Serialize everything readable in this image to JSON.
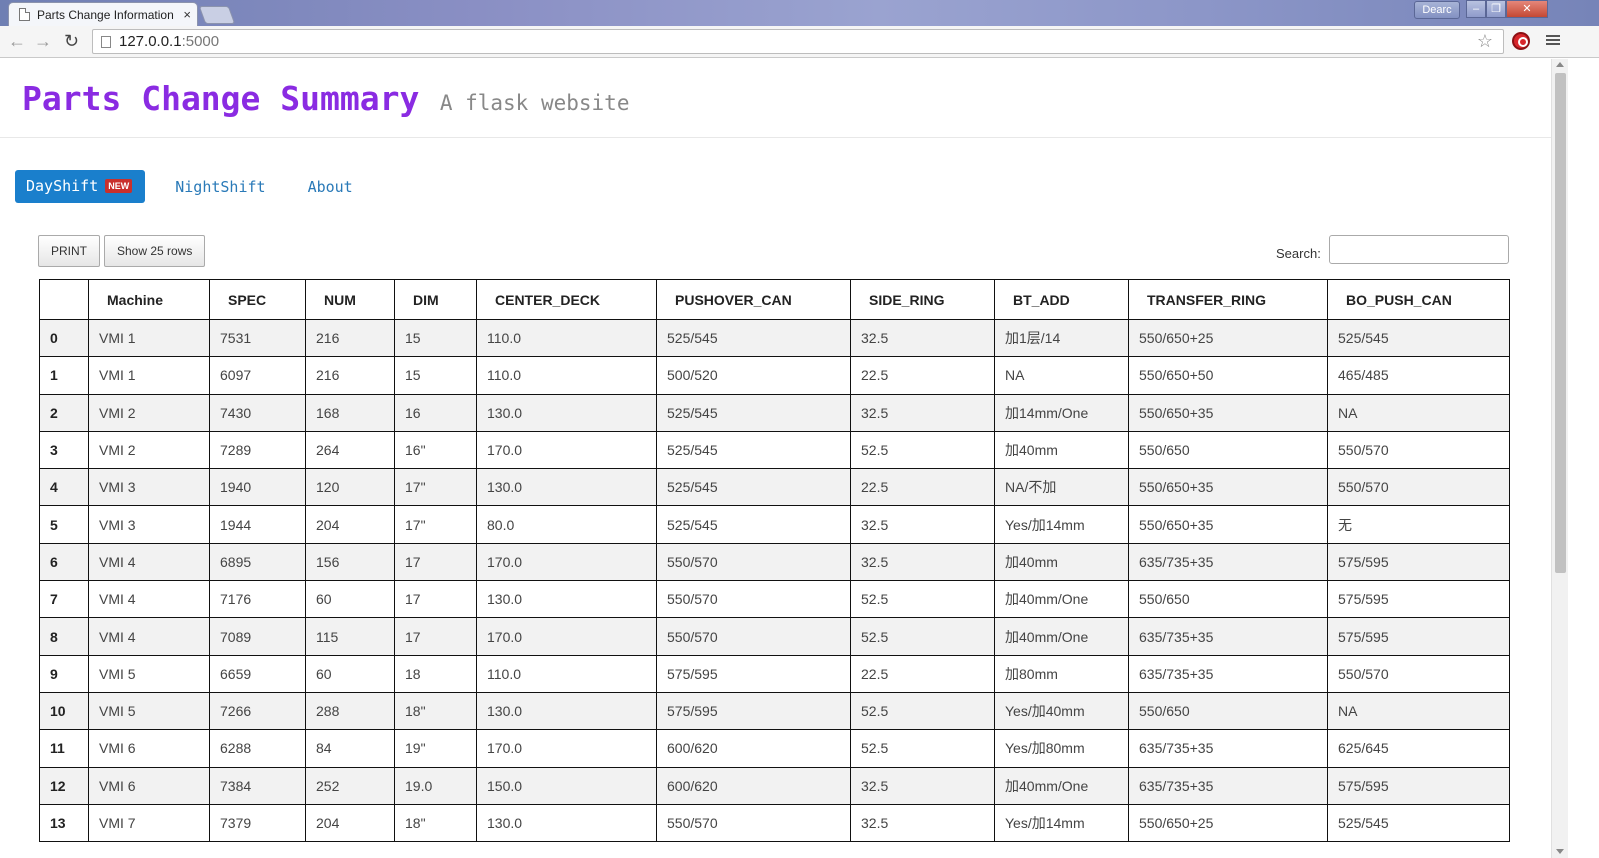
{
  "browser": {
    "tab_title": "Parts Change Information",
    "tab_close": "×",
    "user": "Dearc",
    "address_host": "127.0.0.1",
    "address_port": ":5000",
    "back": "←",
    "forward": "→",
    "reload": "↻",
    "star": "☆"
  },
  "header": {
    "title": "Parts Change Summary",
    "subtitle": "A flask website"
  },
  "nav": {
    "items": [
      "DayShift",
      "NightShift",
      "About"
    ],
    "badge": "NEW"
  },
  "toolbar": {
    "print_label": "PRINT",
    "rows_label": "Show 25 rows",
    "search_label": "Search:",
    "search_value": ""
  },
  "table": {
    "columns": [
      "",
      "Machine",
      "SPEC",
      "NUM",
      "DIM",
      "CENTER_DECK",
      "PUSHOVER_CAN",
      "SIDE_RING",
      "BT_ADD",
      "TRANSFER_RING",
      "BO_PUSH_CAN"
    ],
    "rows": [
      [
        "0",
        "VMI 1",
        "7531",
        "216",
        "15",
        "110.0",
        "525/545",
        "32.5",
        "加1层/14",
        "550/650+25",
        "525/545"
      ],
      [
        "1",
        "VMI 1",
        "6097",
        "216",
        "15",
        "110.0",
        "500/520",
        "22.5",
        "NA",
        "550/650+50",
        "465/485"
      ],
      [
        "2",
        "VMI 2",
        "7430",
        "168",
        "16",
        "130.0",
        "525/545",
        "32.5",
        "加14mm/One",
        "550/650+35",
        "NA"
      ],
      [
        "3",
        "VMI 2",
        "7289",
        "264",
        "16\"",
        "170.0",
        "525/545",
        "52.5",
        "加40mm",
        "550/650",
        "550/570"
      ],
      [
        "4",
        "VMI 3",
        "1940",
        "120",
        "17\"",
        "130.0",
        "525/545",
        "22.5",
        "NA/不加",
        "550/650+35",
        "550/570"
      ],
      [
        "5",
        "VMI 3",
        "1944",
        "204",
        "17\"",
        "80.0",
        "525/545",
        "32.5",
        "Yes/加14mm",
        "550/650+35",
        "无"
      ],
      [
        "6",
        "VMI 4",
        "6895",
        "156",
        "17",
        "170.0",
        "550/570",
        "32.5",
        "加40mm",
        "635/735+35",
        "575/595"
      ],
      [
        "7",
        "VMI 4",
        "7176",
        "60",
        "17",
        "130.0",
        "550/570",
        "52.5",
        "加40mm/One",
        "550/650",
        "575/595"
      ],
      [
        "8",
        "VMI 4",
        "7089",
        "115",
        "17",
        "170.0",
        "550/570",
        "52.5",
        "加40mm/One",
        "635/735+35",
        "575/595"
      ],
      [
        "9",
        "VMI 5",
        "6659",
        "60",
        "18",
        "110.0",
        "575/595",
        "22.5",
        "加80mm",
        "635/735+35",
        "550/570"
      ],
      [
        "10",
        "VMI 5",
        "7266",
        "288",
        "18\"",
        "130.0",
        "575/595",
        "52.5",
        "Yes/加40mm",
        "550/650",
        "NA"
      ],
      [
        "11",
        "VMI 6",
        "6288",
        "84",
        "19\"",
        "170.0",
        "600/620",
        "52.5",
        "Yes/加80mm",
        "635/735+35",
        "625/645"
      ],
      [
        "12",
        "VMI 6",
        "7384",
        "252",
        "19.0",
        "150.0",
        "600/620",
        "32.5",
        "加40mm/One",
        "635/735+35",
        "575/595"
      ],
      [
        "13",
        "VMI 7",
        "7379",
        "204",
        "18\"",
        "130.0",
        "550/570",
        "32.5",
        "Yes/加14mm",
        "550/650+25",
        "525/545"
      ]
    ]
  }
}
